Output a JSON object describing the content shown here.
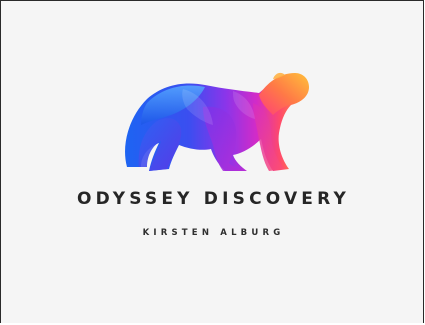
{
  "logo": {
    "icon": "rainbow-bear-icon",
    "title": "ODYSSEY DISCOVERY",
    "subtitle": "KIRSTEN ALBURG"
  },
  "colors": {
    "background": "#f5f5f5",
    "text": "#262626",
    "gradient": [
      "#1e66f0",
      "#6a38f0",
      "#c02fd8",
      "#ff3b7a",
      "#ff9b2e"
    ]
  }
}
